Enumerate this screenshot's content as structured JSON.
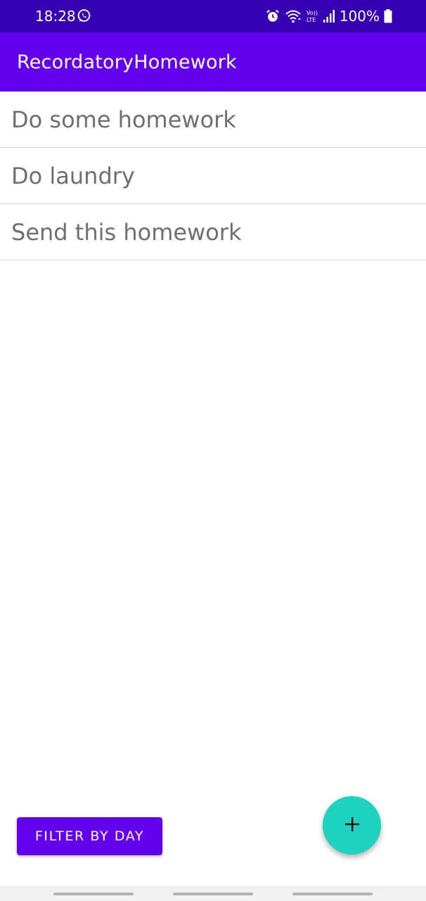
{
  "status_bar": {
    "time": "18:28",
    "battery": "100%",
    "icons": [
      "whatsapp-icon",
      "alarm-icon",
      "wifi-icon",
      "volte-lte-icon",
      "signal-icon",
      "battery-icon"
    ]
  },
  "app_bar": {
    "title": "RecordatoryHomework"
  },
  "tasks": [
    {
      "label": "Do some homework"
    },
    {
      "label": "Do laundry"
    },
    {
      "label": "Send this homework"
    }
  ],
  "filter_button": {
    "label": "FILTER BY DAY"
  },
  "fab": {
    "icon": "plus-icon"
  },
  "colors": {
    "status_bar": "#3700B3",
    "primary": "#6200EE",
    "fab": "#1DD3C0",
    "list_text": "#6F6F6F",
    "divider": "#D4D4D4"
  }
}
